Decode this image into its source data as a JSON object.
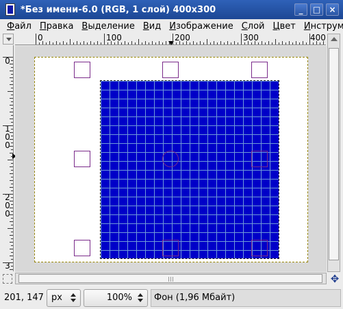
{
  "window": {
    "title": "*Без имени-6.0 (RGB, 1 слой) 400x300",
    "minimize_label": "_",
    "maximize_label": "□",
    "close_label": "×"
  },
  "menu": {
    "file": {
      "first": "Ф",
      "rest": "айл"
    },
    "edit": {
      "first": "П",
      "rest": "равка"
    },
    "select": {
      "first": "В",
      "rest": "ыделение"
    },
    "view": {
      "first": "В",
      "rest": "ид"
    },
    "image": {
      "first": "И",
      "rest": "зображение"
    },
    "layer": {
      "first": "С",
      "rest": "лой"
    },
    "colors": {
      "first": "Ц",
      "rest": "вет"
    },
    "tools": {
      "first": "И",
      "rest": "нструм"
    }
  },
  "rulers": {
    "horizontal_labels": [
      "0",
      "100",
      "200",
      "300",
      "400"
    ],
    "vertical_labels": [
      [
        "0"
      ],
      [
        "1",
        "0",
        "0"
      ],
      [
        "2",
        "0",
        "0"
      ],
      [
        "3"
      ]
    ]
  },
  "colors": {
    "fill": "#0000c8",
    "grid": "#6f9ad8",
    "handle": "#7a2a8a",
    "title_bar": "#2f61b8"
  },
  "statusbar": {
    "coordinates": "201, 147",
    "unit": "px",
    "zoom": "100%",
    "layer_info": "Фон (1,96 Мбайт)"
  },
  "icons": {
    "navigate": "✥"
  }
}
